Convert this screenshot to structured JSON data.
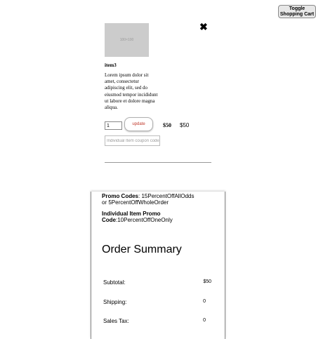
{
  "toolbar": {
    "toggle_line1": "Toggle",
    "toggle_line2": "Shopping Cart"
  },
  "cart_item": {
    "image_placeholder": "100×100",
    "close_glyph": "✖",
    "name": "item3",
    "description": "Lorem ipsum dolor sit amet, consectetur adipiscing elit, sed do eiusmod tempor incididunt ut labore et dolore magna aliqua.",
    "quantity": "1",
    "update_label": "update",
    "unit_price": "$50",
    "line_total": "$50",
    "coupon_placeholder": "Individual Item coupon code"
  },
  "promo": {
    "codes_label": "Promo Codes",
    "codes_text": ": 15PercentOffAllOdds or 5PercentOffWholeOrder",
    "item_label_line1": "Individual Item Promo",
    "item_label_line2": "Code",
    "item_text": ":10PercentOffOneOnly"
  },
  "summary": {
    "title": "Order Summary",
    "rows": [
      {
        "label": "Subtotal:",
        "value": "$50"
      },
      {
        "label": "Shipping:",
        "value": "0"
      },
      {
        "label": "Sales Tax:",
        "value": "0"
      }
    ]
  }
}
